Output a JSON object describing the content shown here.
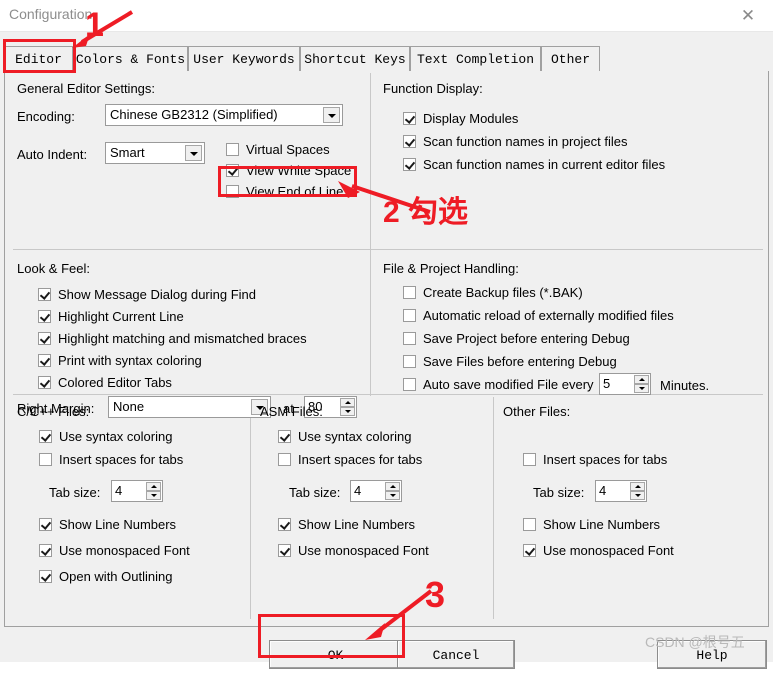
{
  "window": {
    "title": "Configuration",
    "close_icon": "close-icon"
  },
  "tabs": [
    {
      "label": "Editor",
      "selected": true
    },
    {
      "label": "Colors & Fonts",
      "selected": false
    },
    {
      "label": "User Keywords",
      "selected": false
    },
    {
      "label": "Shortcut Keys",
      "selected": false
    },
    {
      "label": "Text Completion",
      "selected": false
    },
    {
      "label": "Other",
      "selected": false
    }
  ],
  "general_editor_settings": {
    "title": "General Editor Settings:",
    "encoding_label": "Encoding:",
    "encoding_value": "Chinese GB2312 (Simplified)",
    "auto_indent_label": "Auto Indent:",
    "auto_indent_value": "Smart",
    "checkboxes": [
      {
        "label": "Virtual Spaces",
        "checked": false
      },
      {
        "label": "View White Space",
        "checked": true
      },
      {
        "label": "View End of Line",
        "checked": false
      }
    ]
  },
  "function_display": {
    "title": "Function Display:",
    "checkboxes": [
      {
        "label": "Display Modules",
        "checked": true
      },
      {
        "label": "Scan function names in project files",
        "checked": true
      },
      {
        "label": "Scan function names in current editor files",
        "checked": true
      }
    ]
  },
  "look_and_feel": {
    "title": "Look & Feel:",
    "checkboxes": [
      {
        "label": "Show Message Dialog during Find",
        "checked": true
      },
      {
        "label": "Highlight Current Line",
        "checked": true
      },
      {
        "label": "Highlight matching and mismatched braces",
        "checked": true
      },
      {
        "label": "Print with syntax coloring",
        "checked": true
      },
      {
        "label": "Colored Editor Tabs",
        "checked": true
      }
    ],
    "right_margin_label": "Right Margin:",
    "right_margin_value": "None",
    "at_label": "at",
    "at_value": "80"
  },
  "file_project_handling": {
    "title": "File & Project Handling:",
    "checkboxes": [
      {
        "label": "Create Backup files (*.BAK)",
        "checked": false
      },
      {
        "label": "Automatic reload of externally modified files",
        "checked": false
      },
      {
        "label": "Save Project before entering Debug",
        "checked": false
      },
      {
        "label": "Save Files before entering Debug",
        "checked": false
      },
      {
        "label": "Auto save modified File every",
        "checked": false
      }
    ],
    "autosave_value": "5",
    "minutes_label": "Minutes."
  },
  "cpp_files": {
    "title": "C/C++ Files:",
    "checkboxes_top": [
      {
        "label": "Use syntax coloring",
        "checked": true
      },
      {
        "label": "Insert spaces for tabs",
        "checked": false
      }
    ],
    "tab_size_label": "Tab size:",
    "tab_size_value": "4",
    "checkboxes_bottom": [
      {
        "label": "Show Line Numbers",
        "checked": true
      },
      {
        "label": "Use monospaced Font",
        "checked": true
      },
      {
        "label": "Open with Outlining",
        "checked": true
      }
    ]
  },
  "asm_files": {
    "title": "ASM Files:",
    "checkboxes_top": [
      {
        "label": "Use syntax coloring",
        "checked": true
      },
      {
        "label": "Insert spaces for tabs",
        "checked": false
      }
    ],
    "tab_size_label": "Tab size:",
    "tab_size_value": "4",
    "checkboxes_bottom": [
      {
        "label": "Show Line Numbers",
        "checked": true
      },
      {
        "label": "Use monospaced Font",
        "checked": true
      }
    ]
  },
  "other_files": {
    "title": "Other Files:",
    "checkboxes_top": [
      {
        "label": "Insert spaces for tabs",
        "checked": false
      }
    ],
    "tab_size_label": "Tab size:",
    "tab_size_value": "4",
    "checkboxes_bottom": [
      {
        "label": "Show Line Numbers",
        "checked": false
      },
      {
        "label": "Use monospaced Font",
        "checked": true
      }
    ]
  },
  "buttons": {
    "ok": "OK",
    "cancel": "Cancel",
    "help": "Help"
  },
  "annotations": {
    "step1": "1",
    "step2": "2",
    "step2_text": "勾选",
    "step3": "3",
    "color": "#ee1c25"
  },
  "watermark": {
    "text": "CSDN @根号五"
  }
}
